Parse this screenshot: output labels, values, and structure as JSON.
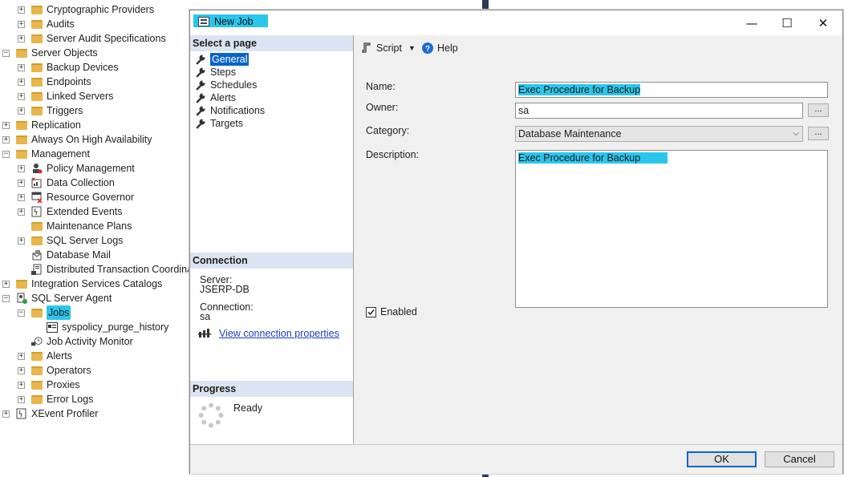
{
  "tree": [
    {
      "label": "Cryptographic Providers",
      "indent": 1,
      "expander": "+",
      "icon": "folder"
    },
    {
      "label": "Audits",
      "indent": 1,
      "expander": "+",
      "icon": "folder"
    },
    {
      "label": "Server Audit Specifications",
      "indent": 1,
      "expander": "+",
      "icon": "folder"
    },
    {
      "label": "Server Objects",
      "indent": 0,
      "expander": "-",
      "icon": "folder"
    },
    {
      "label": "Backup Devices",
      "indent": 1,
      "expander": "+",
      "icon": "folder"
    },
    {
      "label": "Endpoints",
      "indent": 1,
      "expander": "+",
      "icon": "folder"
    },
    {
      "label": "Linked Servers",
      "indent": 1,
      "expander": "+",
      "icon": "folder"
    },
    {
      "label": "Triggers",
      "indent": 1,
      "expander": "+",
      "icon": "folder"
    },
    {
      "label": "Replication",
      "indent": 0,
      "expander": "+",
      "icon": "folder"
    },
    {
      "label": "Always On High Availability",
      "indent": 0,
      "expander": "+",
      "icon": "folder"
    },
    {
      "label": "Management",
      "indent": 0,
      "expander": "-",
      "icon": "folder"
    },
    {
      "label": "Policy Management",
      "indent": 1,
      "expander": "+",
      "icon": "policy"
    },
    {
      "label": "Data Collection",
      "indent": 1,
      "expander": "+",
      "icon": "datacollection"
    },
    {
      "label": "Resource Governor",
      "indent": 1,
      "expander": "+",
      "icon": "resourcegov"
    },
    {
      "label": "Extended Events",
      "indent": 1,
      "expander": "+",
      "icon": "xevents"
    },
    {
      "label": "Maintenance Plans",
      "indent": 1,
      "expander": "",
      "icon": "folder"
    },
    {
      "label": "SQL Server Logs",
      "indent": 1,
      "expander": "+",
      "icon": "folder"
    },
    {
      "label": "Database Mail",
      "indent": 1,
      "expander": "",
      "icon": "dbmail"
    },
    {
      "label": "Distributed Transaction Coordinator",
      "indent": 1,
      "expander": "",
      "icon": "dtc"
    },
    {
      "label": "Integration Services Catalogs",
      "indent": 0,
      "expander": "+",
      "icon": "folder"
    },
    {
      "label": "SQL Server Agent",
      "indent": 0,
      "expander": "-",
      "icon": "agent"
    },
    {
      "label": "Jobs",
      "indent": 1,
      "expander": "-",
      "icon": "folder",
      "highlight": true
    },
    {
      "label": "syspolicy_purge_history",
      "indent": 2,
      "expander": "",
      "icon": "job"
    },
    {
      "label": "Job Activity Monitor",
      "indent": 1,
      "expander": "",
      "icon": "monitor"
    },
    {
      "label": "Alerts",
      "indent": 1,
      "expander": "+",
      "icon": "folder"
    },
    {
      "label": "Operators",
      "indent": 1,
      "expander": "+",
      "icon": "folder"
    },
    {
      "label": "Proxies",
      "indent": 1,
      "expander": "+",
      "icon": "folder"
    },
    {
      "label": "Error Logs",
      "indent": 1,
      "expander": "+",
      "icon": "folder"
    },
    {
      "label": "XEvent Profiler",
      "indent": 0,
      "expander": "+",
      "icon": "xevents"
    }
  ],
  "dialog": {
    "title": "New Job",
    "controls": {
      "minimize": "—",
      "maximize": "☐",
      "close": "✕"
    },
    "select_page_header": "Select a page",
    "pages": [
      "General",
      "Steps",
      "Schedules",
      "Alerts",
      "Notifications",
      "Targets"
    ],
    "selected_page": "General",
    "connection_header": "Connection",
    "server_label": "Server:",
    "server_value": "JSERP-DB",
    "connection_label": "Connection:",
    "connection_value": "sa",
    "view_connection_link": "View connection properties",
    "progress_header": "Progress",
    "progress_status": "Ready",
    "toolbar": {
      "script": "Script",
      "help": "Help"
    },
    "form": {
      "name_label": "Name:",
      "name_value": "Exec Procedure for Backup",
      "owner_label": "Owner:",
      "owner_value": "sa",
      "owner_browse": "...",
      "category_label": "Category:",
      "category_value": "Database Maintenance",
      "category_browse": "...",
      "description_label": "Description:",
      "description_value": "Exec Procedure for Backup",
      "enabled_label": "Enabled",
      "enabled": true
    },
    "buttons": {
      "ok": "OK",
      "cancel": "Cancel"
    }
  },
  "colors": {
    "highlight": "#2cc6ec",
    "selection": "#0a64c8",
    "section_header": "#dbe5f1"
  }
}
